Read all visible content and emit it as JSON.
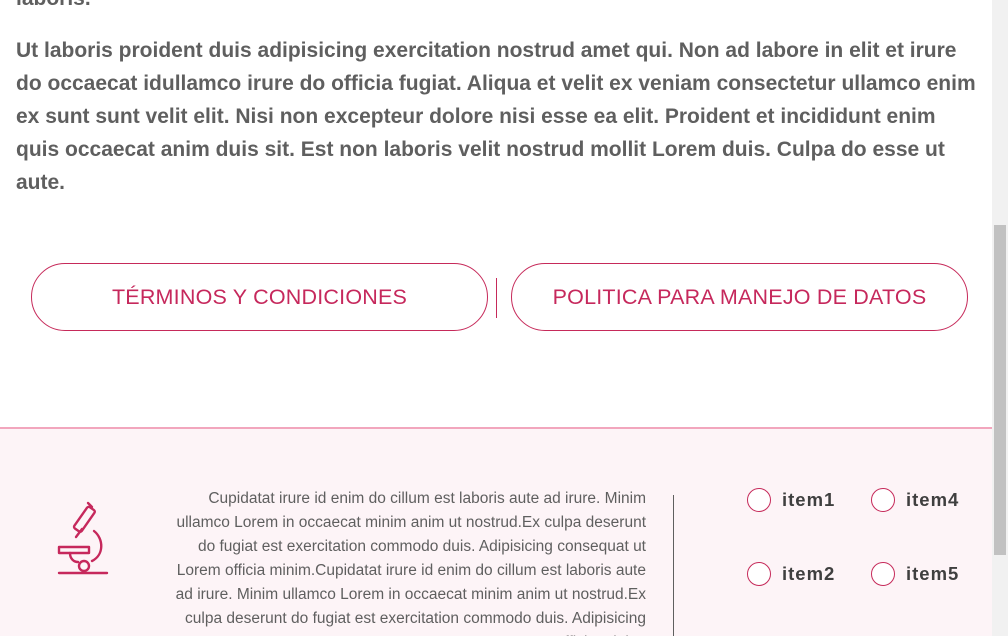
{
  "previous_text_tail": "laboris.",
  "paragraph": "Ut laboris proident duis adipisicing exercitation nostrud amet qui. Non ad labore in elit et irure do occaecat idullamco irure do officia fugiat. Aliqua et velit ex veniam consectetur ullamco enim ex sunt sunt velit elit. Nisi non excepteur dolore nisi esse ea elit. Proident et incididunt enim quis occaecat anim duis sit. Est non laboris velit nostrud mollit Lorem duis. Culpa do esse ut aute.",
  "buttons": {
    "terms": "TÉRMINOS Y CONDICIONES",
    "policy": "POLITICA PARA MANEJO DE DATOS"
  },
  "footer": {
    "icon": "microscope-icon",
    "text": "Cupidatat irure id enim do cillum est laboris aute ad irure. Minim ullamco Lorem in occaecat minim anim ut nostrud.Ex culpa deserunt do fugiat est exercitation commodo duis. Adipisicing consequat ut Lorem officia minim.Cupidatat irure id enim do cillum est laboris aute ad irure. Minim ullamco Lorem in occaecat minim anim ut nostrud.Ex culpa deserunt do fugiat est exercitation commodo duis. Adipisicing consequat ut Lorem officia minim.",
    "items": [
      {
        "label": "item1"
      },
      {
        "label": "item2"
      },
      {
        "label": "item4"
      },
      {
        "label": "item5"
      }
    ]
  },
  "colors": {
    "accent": "#c6285c",
    "text": "#5f5f5f",
    "footer_bg": "#fdf4f7",
    "footer_border": "#f2a6bd"
  }
}
